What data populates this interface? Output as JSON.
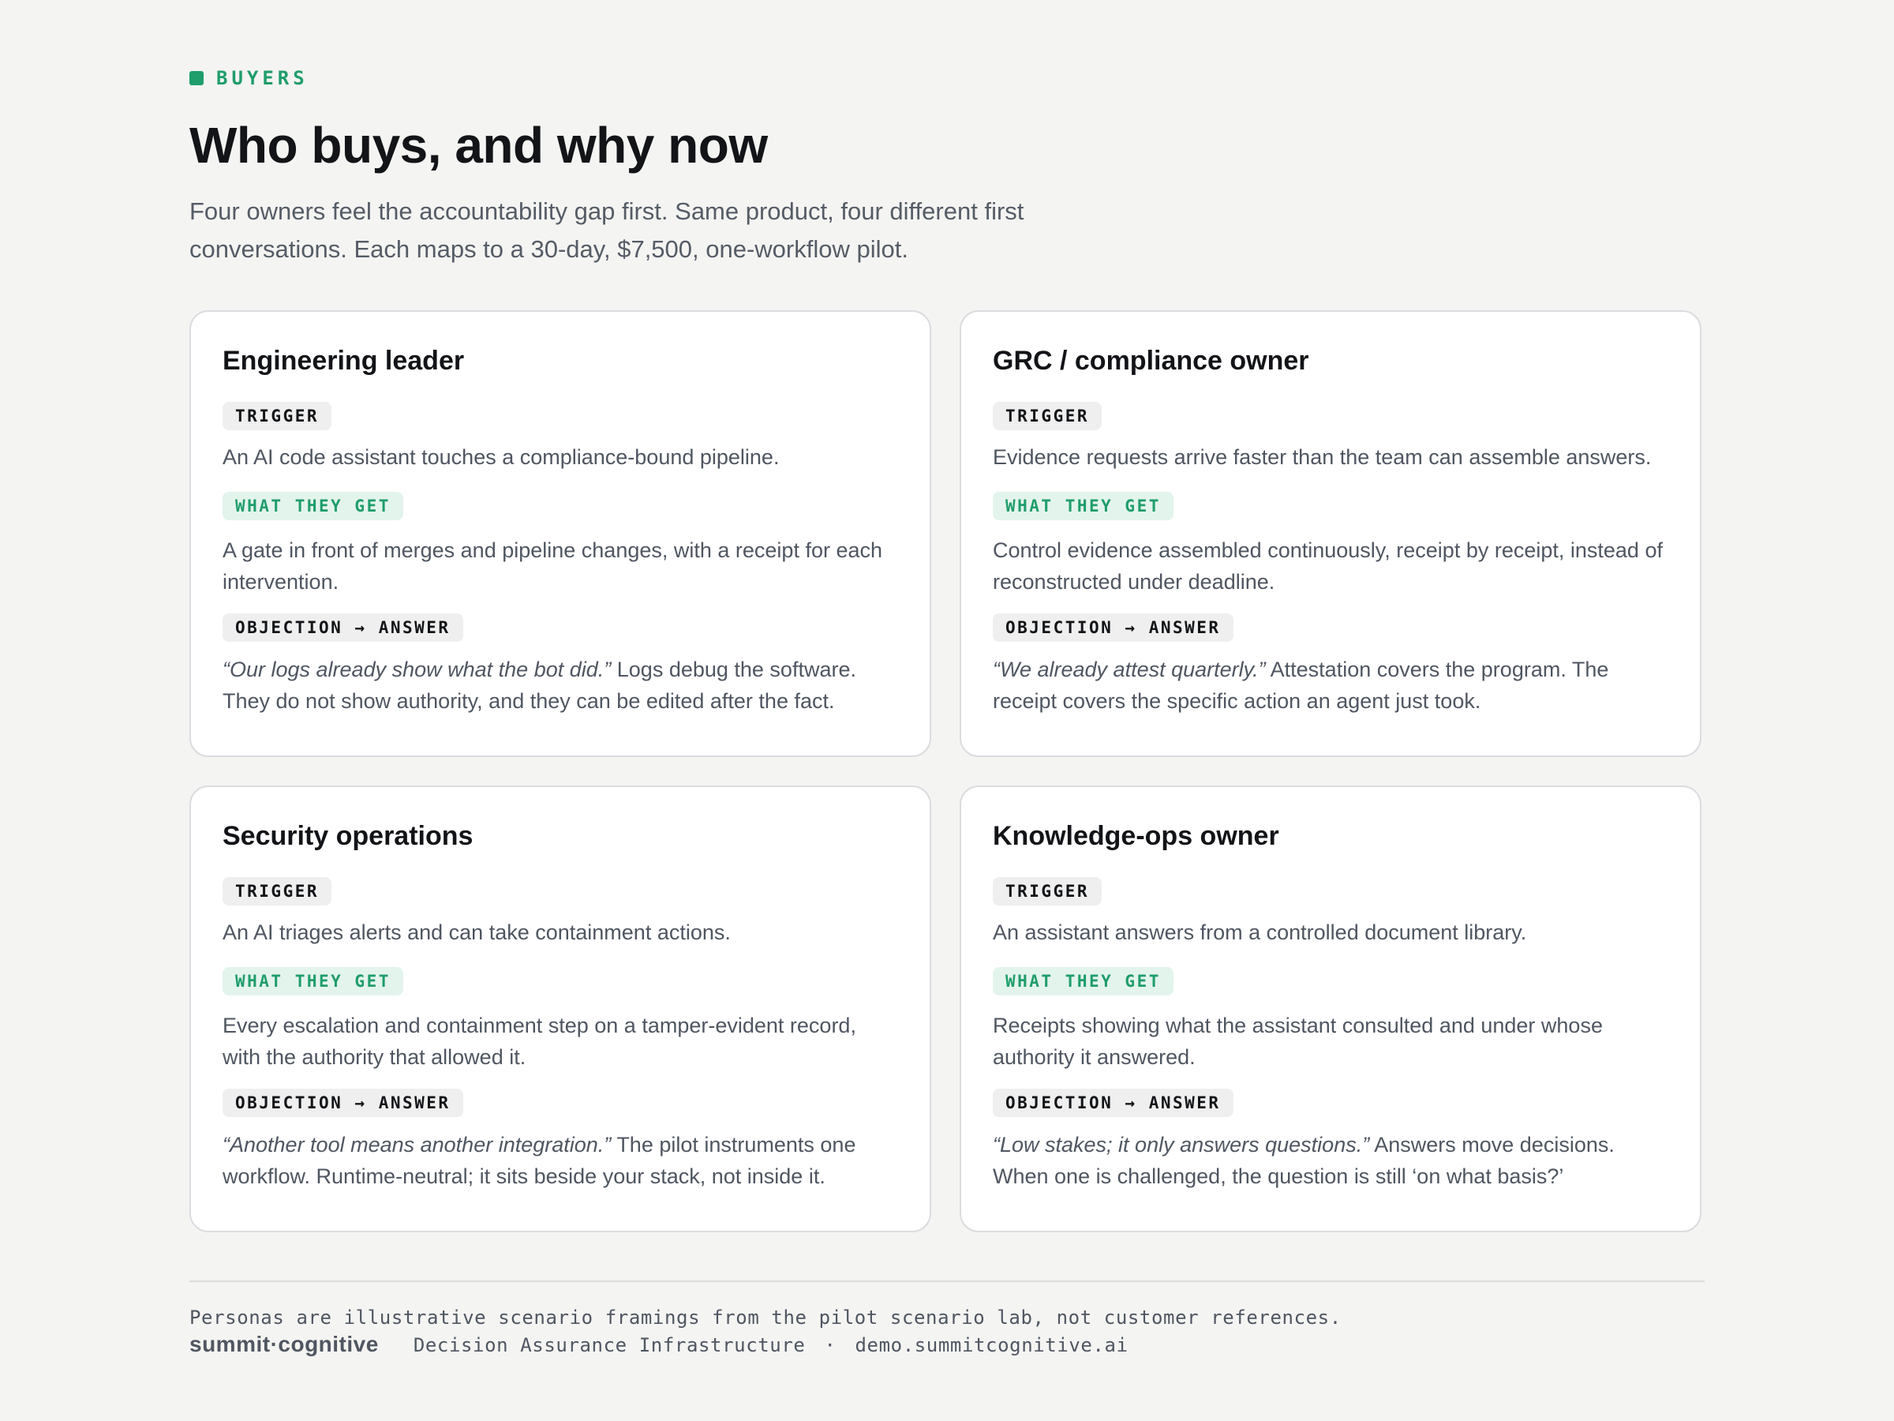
{
  "header": {
    "eyebrow": "BUYERS",
    "title": "Who buys, and why now",
    "lede": "Four owners feel the accountability gap first. Same product, four different first conversations. Each maps to a 30-day, $7,500, one-workflow pilot."
  },
  "labels": {
    "trigger": "TRIGGER",
    "get": "WHAT THEY GET",
    "objection": "OBJECTION → ANSWER"
  },
  "personas": [
    {
      "title": "Engineering leader",
      "trigger": "An AI code assistant touches a compliance-bound pipeline.",
      "get": "A gate in front of merges and pipeline changes, with a receipt for each intervention.",
      "objection_quote": "“Our logs already show what the bot did.”",
      "answer": "Logs debug the software. They do not show authority, and they can be edited after the fact."
    },
    {
      "title": "GRC / compliance owner",
      "trigger": "Evidence requests arrive faster than the team can assemble answers.",
      "get": "Control evidence assembled continuously, receipt by receipt, instead of reconstructed under deadline.",
      "objection_quote": "“We already attest quarterly.”",
      "answer": "Attestation covers the program. The receipt covers the specific action an agent just took."
    },
    {
      "title": "Security operations",
      "trigger": "An AI triages alerts and can take containment actions.",
      "get": "Every escalation and containment step on a tamper-evident record, with the authority that allowed it.",
      "objection_quote": "“Another tool means another integration.”",
      "answer": "The pilot instruments one workflow. Runtime-neutral; it sits beside your stack, not inside it."
    },
    {
      "title": "Knowledge-ops owner",
      "trigger": "An assistant answers from a controlled document library.",
      "get": "Receipts showing what the assistant consulted and under whose authority it answered.",
      "objection_quote": "“Low stakes; it only answers questions.”",
      "answer": "Answers move decisions. When one is challenged, the question is still ‘on what basis?’"
    }
  ],
  "footer": {
    "disclaimer": "Personas are illustrative scenario framings from the pilot scenario lab, not customer references.",
    "brand": "summit·cognitive",
    "tagline": "Decision Assurance Infrastructure",
    "separator": "·",
    "url": "demo.summitcognitive.ai"
  },
  "colors": {
    "accent": "#1f9d6b",
    "background": "#f4f4f2",
    "card": "#ffffff",
    "text_dark": "#121417",
    "text_muted": "#4f5661"
  }
}
